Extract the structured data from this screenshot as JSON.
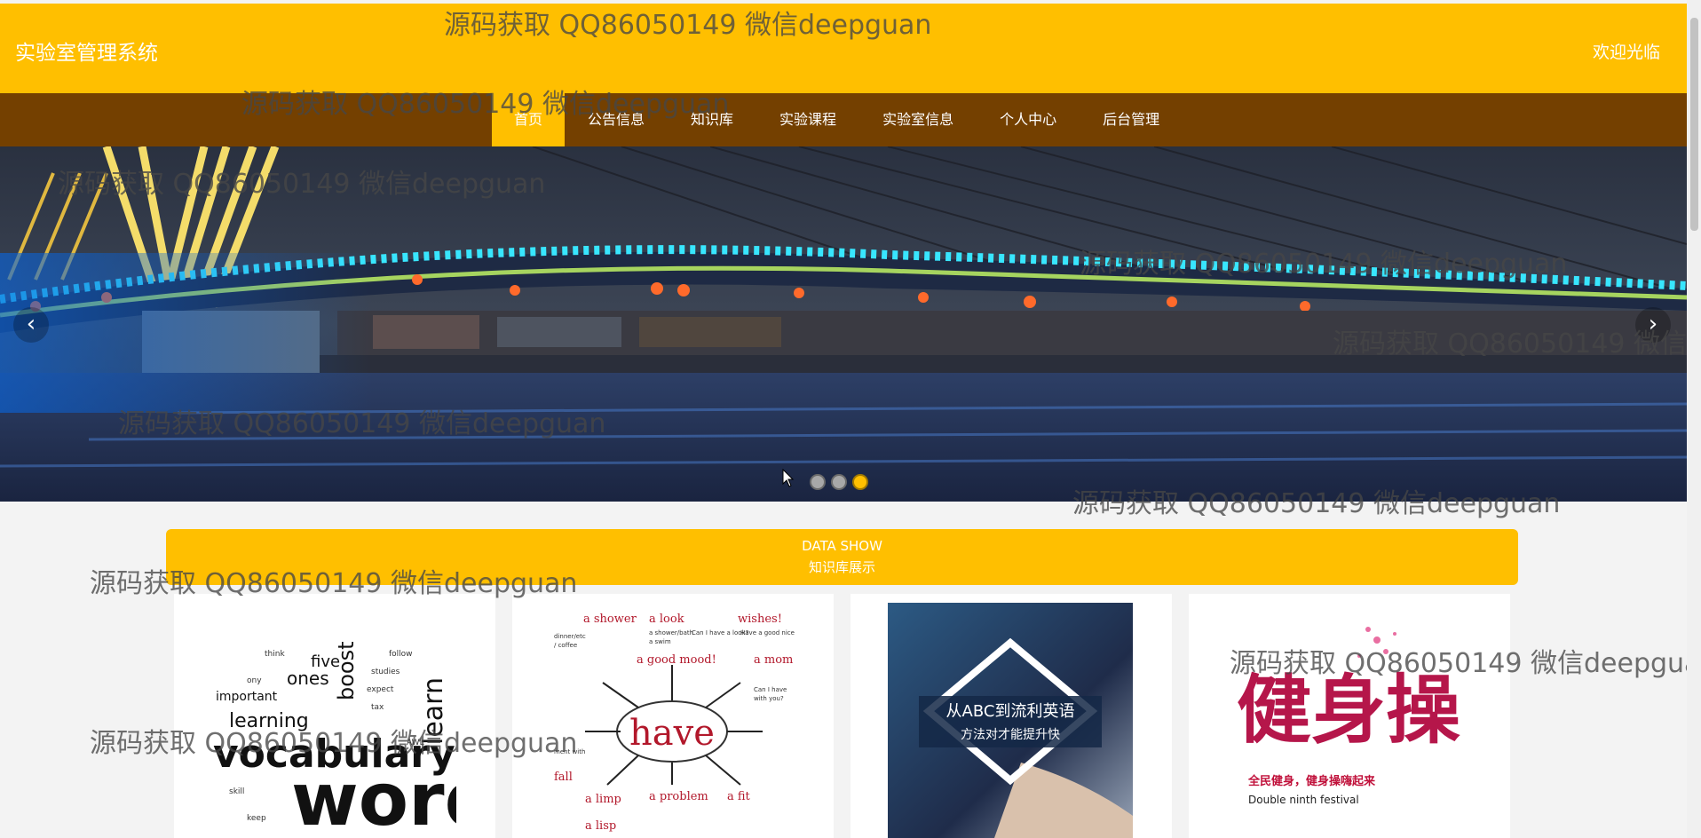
{
  "header": {
    "title": "实验室管理系统",
    "welcome": "欢迎光临"
  },
  "nav": [
    {
      "label": "首页"
    },
    {
      "label": "公告信息"
    },
    {
      "label": "知识库"
    },
    {
      "label": "实验课程"
    },
    {
      "label": "实验室信息"
    },
    {
      "label": "个人中心"
    },
    {
      "label": "后台管理"
    }
  ],
  "carousel": {
    "left_arrow": "‹",
    "right_arrow": "›",
    "slide_count": 3,
    "active_slide": 3
  },
  "section": {
    "title_en": "DATA SHOW",
    "title_zh": "知识库展示"
  },
  "cards": [
    {
      "image": "vocabulary-word-cloud",
      "words": [
        "vocabulary",
        "word",
        "learning",
        "important",
        "ones",
        "boost",
        "five",
        "learn"
      ]
    },
    {
      "image": "have-mind-map",
      "center_word": "have",
      "words": [
        "a shower",
        "a look",
        "wishes!",
        "a good mood!",
        "a mom",
        "a problem",
        "a fit",
        "a limp",
        "a lisp",
        "fall"
      ]
    },
    {
      "image": "english-course-poster",
      "line1": "从ABC到流利英语",
      "line2": "方法对才能提升快"
    },
    {
      "image": "fitness-poster",
      "headline": "健身操",
      "line1": "全民健身，健身操嗨起来",
      "line2": "Double ninth festival"
    }
  ],
  "watermark": "源码获取 QQ86050149 微信deepguan",
  "colors": {
    "accent": "#ffbf00",
    "nav_bg": "#744000",
    "page_bg": "#f3f3f3"
  }
}
